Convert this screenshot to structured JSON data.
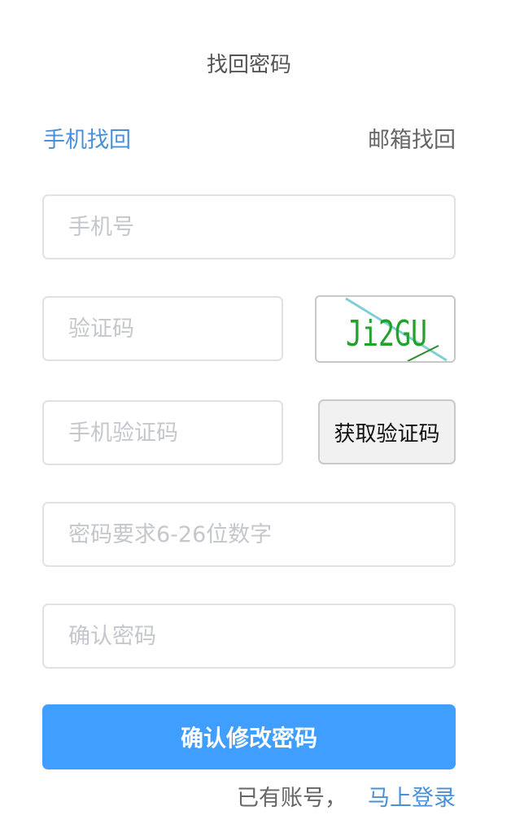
{
  "header": {
    "title": "找回密码"
  },
  "tabs": {
    "phone": "手机找回",
    "email": "邮箱找回"
  },
  "form": {
    "phone_placeholder": "手机号",
    "captcha_placeholder": "验证码",
    "captcha_text": "Ji2GU",
    "sms_placeholder": "手机验证码",
    "sms_button": "获取验证码",
    "password_placeholder": "密码要求6-26位数字",
    "confirm_placeholder": "确认密码",
    "submit_label": "确认修改密码"
  },
  "footer": {
    "prompt": "已有账号，",
    "login_link": "马上登录"
  },
  "colors": {
    "primary": "#409eff",
    "link": "#4a90d9",
    "captcha_text": "#22a22a",
    "captcha_line": "#7fd0d6"
  }
}
